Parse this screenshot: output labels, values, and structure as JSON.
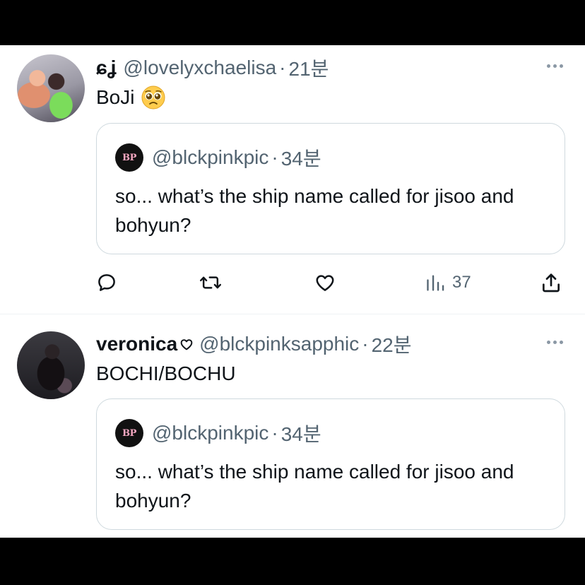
{
  "tweets": [
    {
      "name": "ɕʝ",
      "handle": "@lovelyxchaelisa",
      "separator": "·",
      "time": "21분",
      "text": "BoJi",
      "emoji_icon": "pleading-face-emoji",
      "quote": {
        "avatar_text": "BP",
        "handle": "@blckpinkpic",
        "separator": "·",
        "time": "34분",
        "text": "so... what’s the ship name called for jisoo and bohyun?"
      },
      "actions": {
        "reply_icon": "reply-icon",
        "retweet_icon": "retweet-icon",
        "like_icon": "heart-icon",
        "views_icon": "views-icon",
        "views_count": "37",
        "share_icon": "share-icon"
      }
    },
    {
      "name": "veronica",
      "name_suffix_icon": "heart-outline-icon",
      "handle": "@blckpinksapphic",
      "separator": "·",
      "time": "22분",
      "text": "BOCHI/BOCHU",
      "quote": {
        "avatar_text": "BP",
        "handle": "@blckpinkpic",
        "separator": "·",
        "time": "34분",
        "text": "so... what’s the ship name called for jisoo and bohyun?"
      }
    }
  ],
  "colors": {
    "text_primary": "#0f1419",
    "text_secondary": "#536471",
    "border": "#cfd9de",
    "bp_pink": "#f4a6c0"
  }
}
